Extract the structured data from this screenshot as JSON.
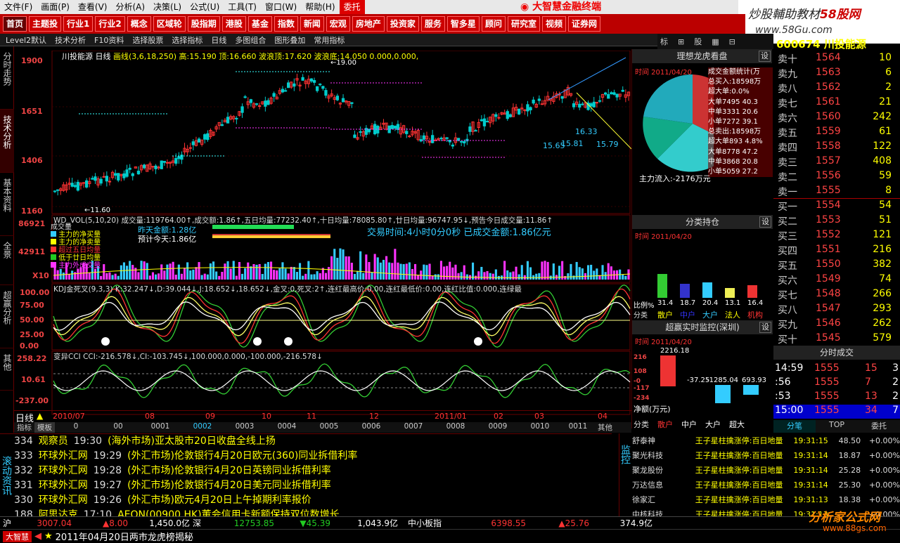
{
  "menu": [
    "文件(F)",
    "画面(P)",
    "查看(V)",
    "分析(A)",
    "决策(L)",
    "公式(U)",
    "工具(T)",
    "窗口(W)",
    "帮助(H)",
    "委托"
  ],
  "brand": "大智慧金融终端",
  "watermark": {
    "line1a": "炒股輔助教材",
    "line1b": "58股网",
    "line2": "www.58Gu.com"
  },
  "nav": [
    "首页",
    "主题投",
    "行业1",
    "行业2",
    "概念",
    "区域轮",
    "股指期",
    "港股",
    "基金",
    "指数",
    "新闻",
    "宏观",
    "房地产",
    "投资家",
    "服务",
    "智多星",
    "顾问",
    "研究室",
    "视频",
    "证券网"
  ],
  "toolbar": [
    "Level2默认",
    "技术分析",
    "F10资料",
    "选择股票",
    "选择指标",
    "日线",
    "多图组合",
    "图形叠加",
    "常用指标"
  ],
  "side": [
    "分时走势",
    "技术分析",
    "基本资料",
    "全景",
    "超赢分析",
    "其他"
  ],
  "chart": {
    "header": "川投能源 日线",
    "legend": "画线(3,6,18,250) 高:15.190 顶:16.660 波浪顶:17.620 波浪底:14.050 0.000,0.000,",
    "y": [
      "1900",
      "1651",
      "1406",
      "1160"
    ],
    "low_label": "11.60",
    "top_label": "19.00",
    "ann": [
      "16.33",
      "15.81",
      "15.65",
      "15.79"
    ],
    "vol_legend": "WD_VOL(5,10,20) 成交量:119764.00↑,成交额:1.86↑,五日均量:77232.40↑,十日均量:78085.80↑,廿日均量:96747.95↓,预告今日成交量:11.86↑",
    "vol_y": [
      "86921",
      "42911",
      "X10"
    ],
    "vol_tip": [
      "昨天金额:1.28亿",
      "预计今天:1.86亿"
    ],
    "vol_time": "交易时间:4小时0分0秒 已成交金额:1.86亿元",
    "vol_keys": [
      "主力的净买量",
      "主力的净卖量",
      "超过五日均量",
      "低于廿日均量",
      "主力外成交量"
    ],
    "kdj_legend": "KDJ金死叉(9,3,3) K:32.247↓,D:39.044↓,J:18.652↓,18.652↓,金叉:0,死叉:2↑,连红最高价:0.00,连红最低价:0.00,连红比值:0.000,连绿最",
    "kdj_y": [
      "100.00",
      "75.00",
      "50.00",
      "25.00",
      "0.00"
    ],
    "cci_legend": "变异CCI CCI:-216.578↓,CI:-103.745↓,100.000,0.000,-100.000,-216.578↓",
    "cci_y": [
      "258.22",
      "10.61",
      "-237.00"
    ],
    "dates": [
      "2010/07",
      "08",
      "09",
      "10",
      "11",
      "12",
      "2011/01",
      "02",
      "03",
      "04"
    ],
    "mode": "日线",
    "tabs": [
      "指标",
      "模板",
      "0",
      "00",
      "0001",
      "0002",
      "0003",
      "0004",
      "0005",
      "0006",
      "0007",
      "0008",
      "0009",
      "0010",
      "0011",
      "其他"
    ]
  },
  "dragon": {
    "title": "理想龙虎看盘",
    "set": "设",
    "time": "时间 2011/04/20",
    "pie_legend": [
      "成交金额统计(万",
      "总买入:18598万",
      "超大单:0.0%",
      "大单7495 40.3",
      "中单3331 20.6",
      "小单7272 39.1",
      "总卖出:18598万",
      "超大单893 4.8%",
      "大单8778 47.2",
      "中单3868 20.8",
      "小单5059 27.2"
    ],
    "inflow": "主力流入:-2176万元",
    "pos_title": "分类持仓",
    "pos_time": "时间 2011/04/20",
    "pos_vals": [
      "31.4",
      "18.7",
      "20.4",
      "13.1",
      "16.4"
    ],
    "pos_labels": [
      "散户",
      "中户",
      "大户",
      "法人",
      "机构"
    ],
    "pos_ratio": "比例%",
    "pos_kind": "分类",
    "mon_title": "超赢实时监控(深圳)",
    "mon_time": "时间 2011/04/20",
    "mon_vals": [
      "2216.18",
      "-37.25",
      "-1285.04",
      "693.93"
    ],
    "mon_y": [
      "216",
      "108",
      "-0",
      "-117",
      "-234"
    ],
    "mon_unit": "净额(万元)",
    "mon_labels": [
      "分类",
      "散户",
      "中户",
      "大户",
      "超大"
    ]
  },
  "book": {
    "code": "600674 川投能源",
    "sell": [
      [
        "卖十",
        "1564",
        "10"
      ],
      [
        "卖九",
        "1563",
        "6"
      ],
      [
        "卖八",
        "1562",
        "2"
      ],
      [
        "卖七",
        "1561",
        "21"
      ],
      [
        "卖六",
        "1560",
        "242"
      ],
      [
        "卖五",
        "1559",
        "61"
      ],
      [
        "卖四",
        "1558",
        "122"
      ],
      [
        "卖三",
        "1557",
        "408"
      ],
      [
        "卖二",
        "1556",
        "59"
      ],
      [
        "卖一",
        "1555",
        "8"
      ]
    ],
    "buy": [
      [
        "买一",
        "1554",
        "54"
      ],
      [
        "买二",
        "1553",
        "51"
      ],
      [
        "买三",
        "1552",
        "121"
      ],
      [
        "买四",
        "1551",
        "216"
      ],
      [
        "买五",
        "1550",
        "382"
      ],
      [
        "买六",
        "1549",
        "74"
      ],
      [
        "买七",
        "1548",
        "266"
      ],
      [
        "买八",
        "1547",
        "293"
      ],
      [
        "买九",
        "1546",
        "262"
      ],
      [
        "买十",
        "1545",
        "579"
      ]
    ]
  },
  "ticks": {
    "title": "分时成交",
    "rows": [
      [
        "14:59",
        "1555",
        "15",
        "3"
      ],
      [
        ":56",
        "1555",
        "7",
        "2"
      ],
      [
        ":53",
        "1555",
        "13",
        "2"
      ],
      [
        "15:00",
        "1555",
        "34",
        "7"
      ]
    ],
    "tabs": [
      "分笔",
      "TOP",
      "委托"
    ]
  },
  "news": {
    "label": "滚动资讯",
    "rows": [
      [
        "334",
        "观察员",
        "19:30",
        "(海外市场)亚太股市20日收盘全线上扬"
      ],
      [
        "333",
        "环球外汇网",
        "19:29",
        "(外汇市场)伦敦银行4月20日欧元(360)同业拆借利率"
      ],
      [
        "332",
        "环球外汇网",
        "19:28",
        "(外汇市场)伦敦银行4月20日英镑同业拆借利率"
      ],
      [
        "331",
        "环球外汇网",
        "19:27",
        "(外汇市场)伦敦银行4月20日美元同业拆借利率"
      ],
      [
        "330",
        "环球外汇网",
        "19:26",
        "(外汇市场)欧元4月20日上午掉期利率报价"
      ],
      [
        "188",
        "阿思达克",
        "17:10",
        "AEON(00900.HK)董会信用卡新额保持双位数增长"
      ]
    ]
  },
  "monitor": {
    "label": "监控",
    "rows": [
      [
        "舒泰神",
        "王子星柱擒涨停:百日地量",
        "19:31:15",
        "48.50",
        "+0.00%"
      ],
      [
        "聚光科技",
        "王子星柱擒涨停:百日地量",
        "19:31:14",
        "18.87",
        "+0.00%"
      ],
      [
        "聚龙股份",
        "王子星柱擒涨停:百日地量",
        "19:31:14",
        "25.28",
        "+0.00%"
      ],
      [
        "万达信息",
        "王子星柱擒涨停:百日地量",
        "19:31:14",
        "25.30",
        "+0.00%"
      ],
      [
        "徐家汇",
        "王子星柱擒涨停:百日地量",
        "19:31:13",
        "18.38",
        "+0.00%"
      ],
      [
        "中核科技",
        "王子星柱擒涨停:百日地量",
        "19:31:13",
        "",
        "+0.00%"
      ]
    ]
  },
  "status": {
    "sh": "沪",
    "sh_idx": "3007.04",
    "sh_chg": "▲8.00",
    "sh_amt": "1,450.0亿",
    "sz": "深",
    "sz_idx": "12753.85",
    "sz_chg": "▼45.39",
    "sz_amt": "1,043.9亿",
    "sme": "中小板指",
    "sme_idx": "6398.55",
    "sme_chg": "▲25.76",
    "sme_amt": "374.9亿"
  },
  "bottom": {
    "logo": "大智慧",
    "text": "2011年04月20日两市龙虎榜揭秘"
  },
  "footer_brand": "分析家公式网",
  "footer_url": "www.88gs.com"
}
